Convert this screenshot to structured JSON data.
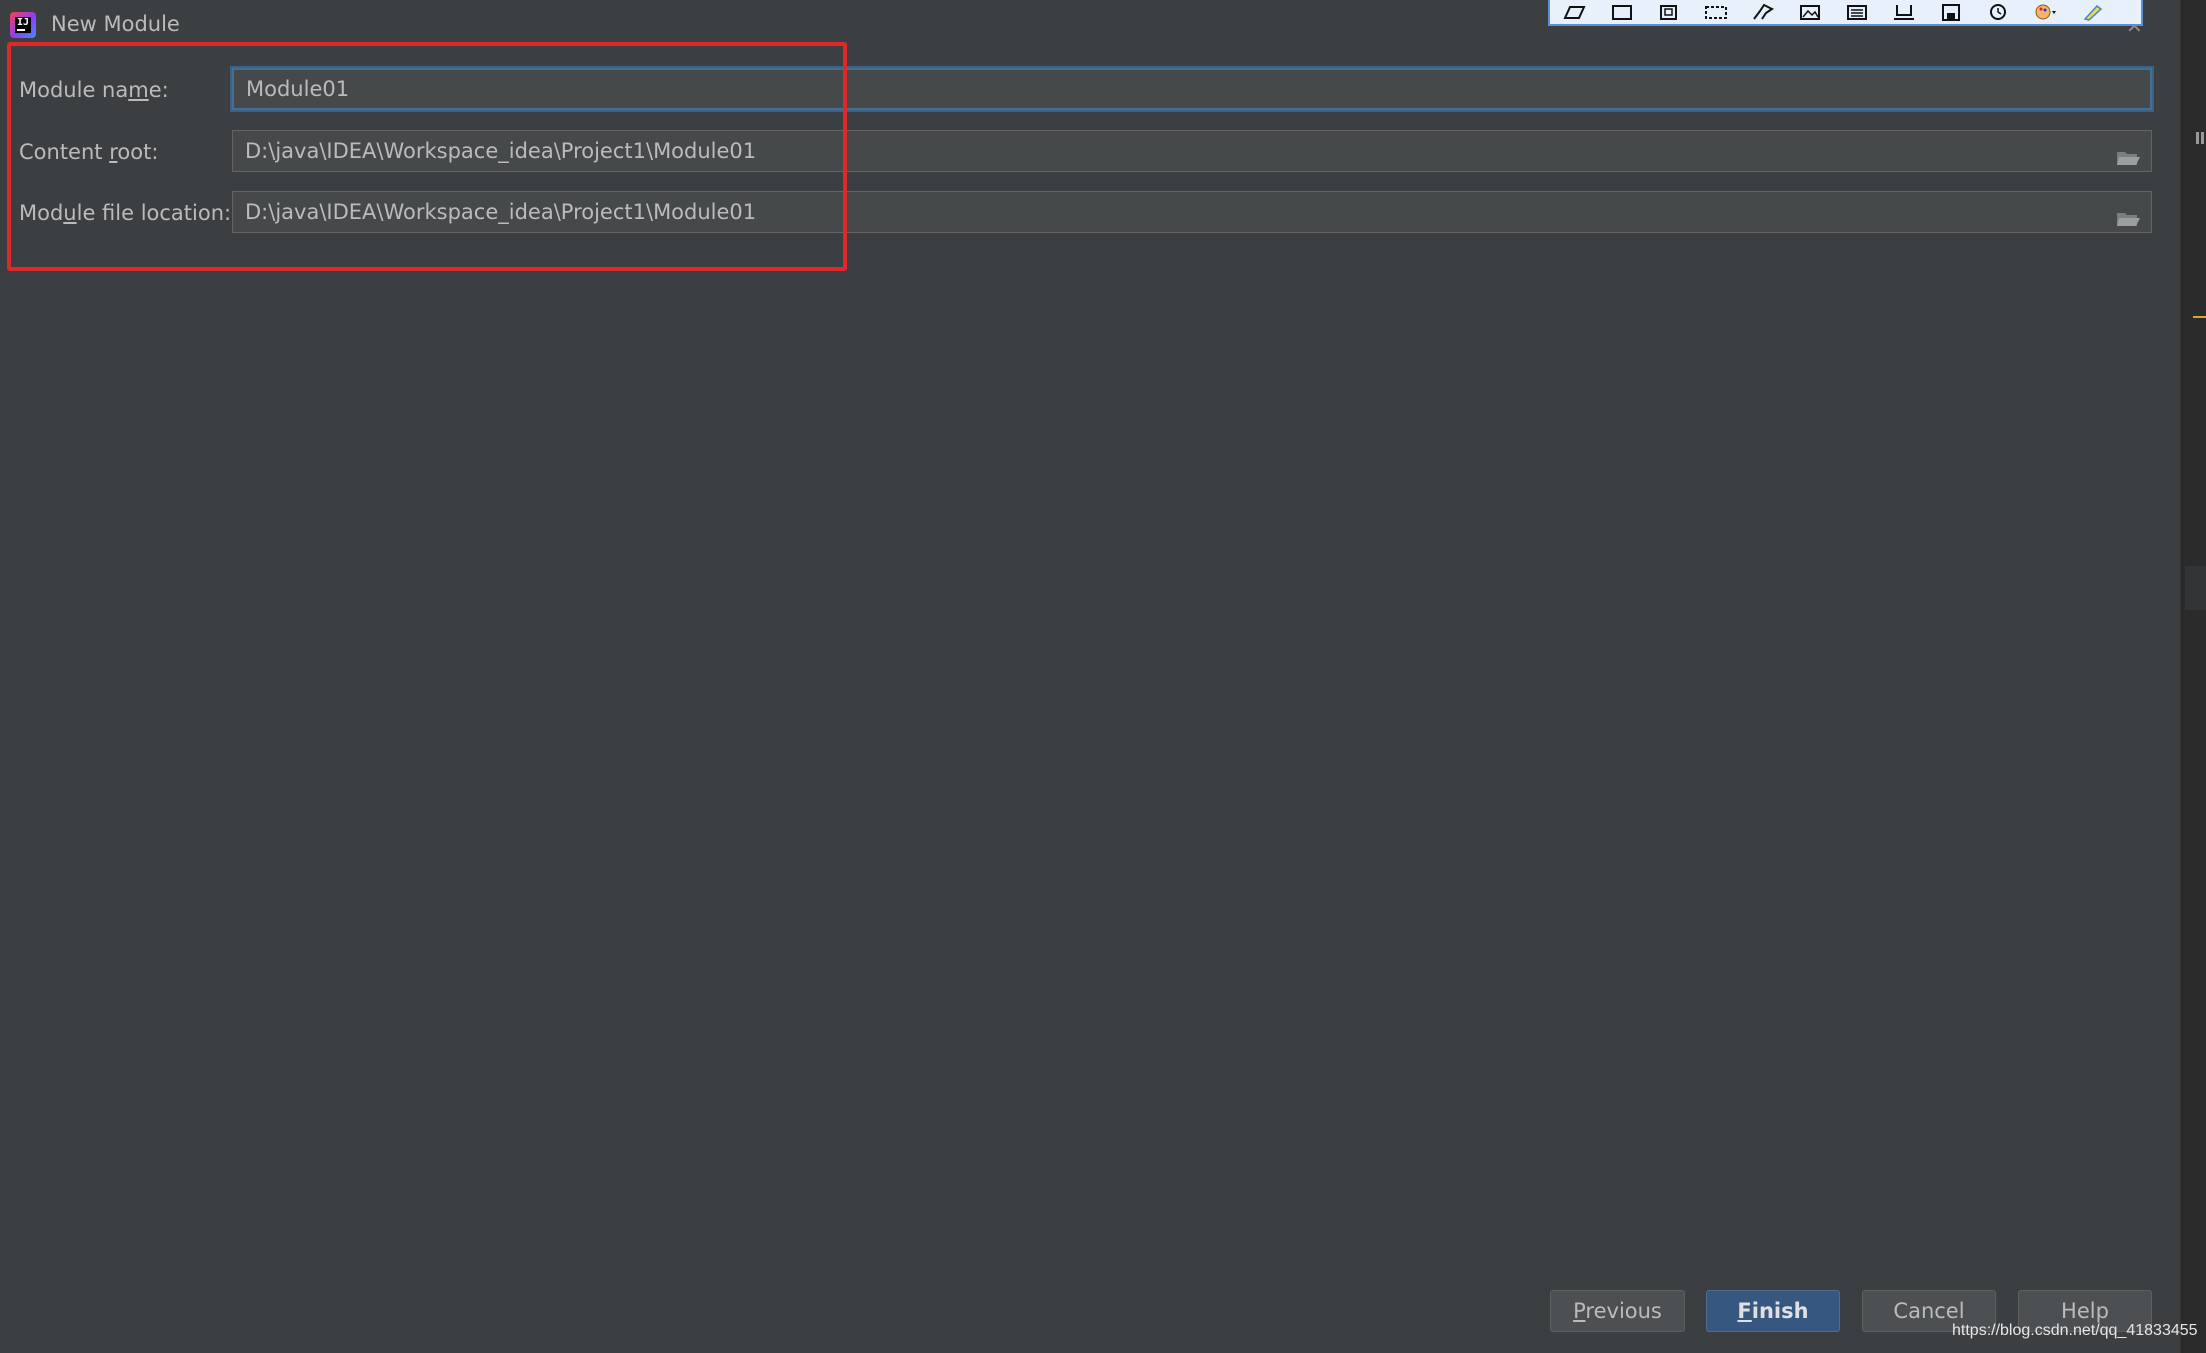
{
  "window": {
    "title": "New Module",
    "close_glyph": "✕"
  },
  "capture_toolbar": {
    "icons": [
      "pen-icon",
      "rectangle-icon",
      "copy-icon",
      "marquee-icon",
      "pin-icon",
      "image-icon",
      "save-image-icon",
      "print-icon",
      "floppy-icon",
      "clock-icon",
      "palette-icon",
      "brush-icon"
    ]
  },
  "form": {
    "module_name": {
      "label_pre": "Module na",
      "label_mnemonic": "m",
      "label_post": "e:",
      "value": "Module01"
    },
    "content_root": {
      "label_pre": "Content ",
      "label_mnemonic": "r",
      "label_post": "oot:",
      "value": "D:\\java\\IDEA\\Workspace_idea\\Project1\\Module01"
    },
    "module_file_location": {
      "label_pre": "Mod",
      "label_mnemonic": "u",
      "label_post": "le file location:",
      "value": "D:\\java\\IDEA\\Workspace_idea\\Project1\\Module01"
    }
  },
  "buttons": {
    "previous": {
      "mnemonic": "P",
      "rest": "revious"
    },
    "finish": {
      "mnemonic": "F",
      "rest": "inish"
    },
    "cancel": {
      "label": "Cancel"
    },
    "help": {
      "label": "Help"
    }
  },
  "watermark": "https://blog.csdn.net/qq_41833455",
  "colors": {
    "background": "#3c3f41",
    "input_background": "#45494a",
    "focus_border": "#466d94",
    "highlight_box": "#e02828",
    "default_button": "#365880"
  }
}
